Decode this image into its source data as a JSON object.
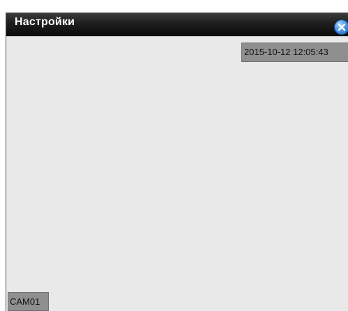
{
  "window": {
    "title": "Настройки",
    "close_icon": "close-icon"
  },
  "video": {
    "timestamp": "2015-10-12  12:05:43",
    "camera_label": "CAM01"
  },
  "colors": {
    "titlebar": "#1f1f1f",
    "close_button": "#4b97e6",
    "viewport": "#e9e9e9",
    "osd_background": "#8f8f8f"
  }
}
